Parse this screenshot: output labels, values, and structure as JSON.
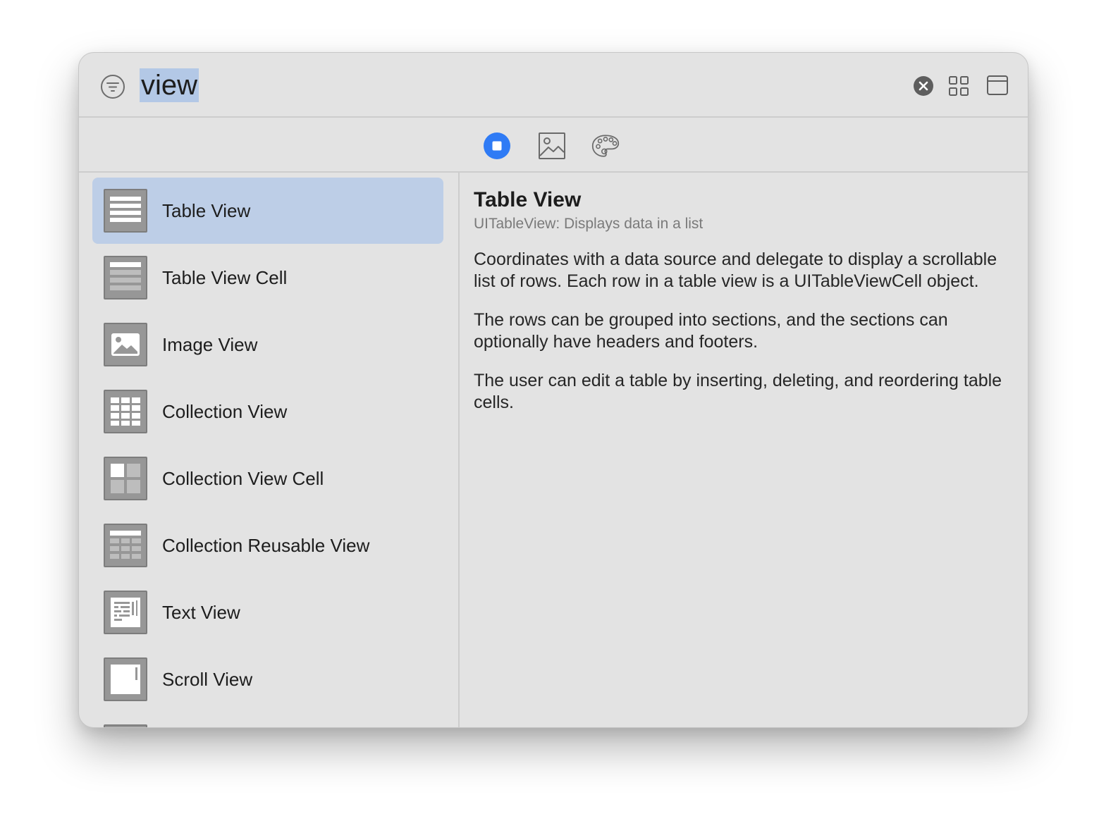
{
  "search": {
    "query": "view"
  },
  "icons": {
    "filter": "filter-icon",
    "clear": "clear-icon",
    "grid": "grid-view-icon",
    "window": "window-icon"
  },
  "tabs": [
    {
      "name": "objects",
      "icon": "stop-circle-icon",
      "active": true,
      "color": "#2f7bf5"
    },
    {
      "name": "media",
      "icon": "photo-icon",
      "active": false
    },
    {
      "name": "colors",
      "icon": "palette-icon",
      "active": false
    }
  ],
  "list": {
    "items": [
      {
        "label": "Table View",
        "icon": "table-view-icon",
        "selected": true
      },
      {
        "label": "Table View Cell",
        "icon": "table-view-cell-icon"
      },
      {
        "label": "Image View",
        "icon": "image-view-icon"
      },
      {
        "label": "Collection View",
        "icon": "collection-view-icon"
      },
      {
        "label": "Collection View Cell",
        "icon": "collection-view-cell-icon"
      },
      {
        "label": "Collection Reusable View",
        "icon": "collection-reusable-view-icon"
      },
      {
        "label": "Text View",
        "icon": "text-view-icon"
      },
      {
        "label": "Scroll View",
        "icon": "scroll-view-icon"
      }
    ]
  },
  "detail": {
    "title": "Table View",
    "subtitle": "UITableView: Displays data in a list",
    "paragraphs": [
      "Coordinates with a data source and delegate to display a scrollable list of rows. Each row in a table view is a UITableViewCell object.",
      "The rows can be grouped into sections, and the sections can optionally have headers and footers.",
      "The user can edit a table by inserting, deleting, and reordering table cells."
    ]
  },
  "colors": {
    "accent": "#2f7bf5",
    "selection": "#bdcee7",
    "window_bg": "#e3e3e3"
  }
}
